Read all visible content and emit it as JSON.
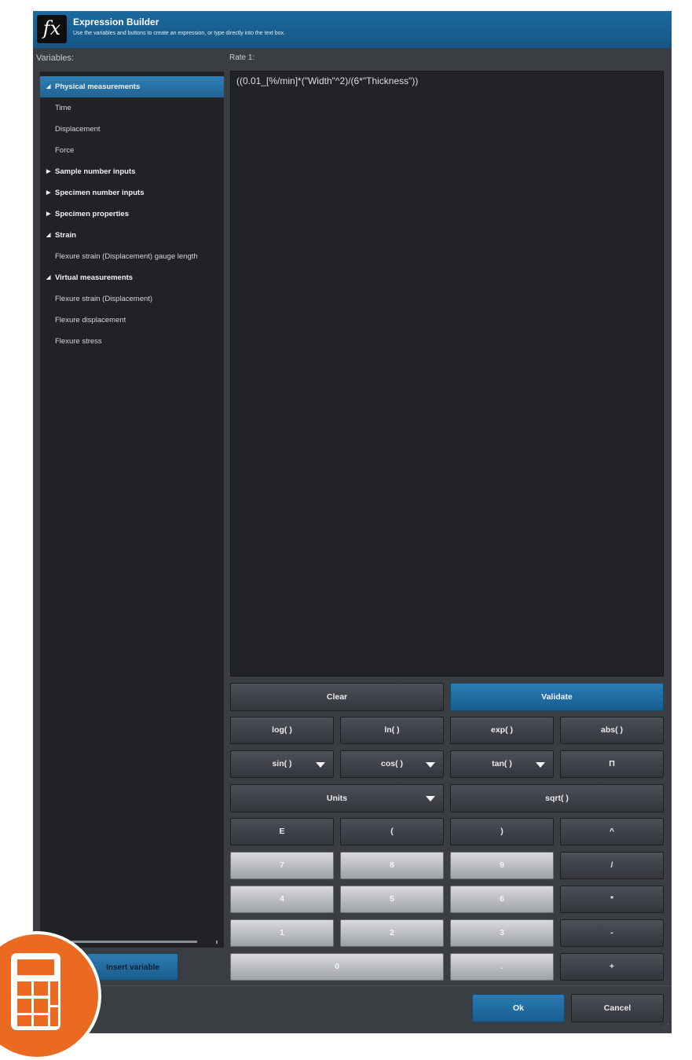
{
  "window": {
    "title": "Expression Builder",
    "subtitle": "Use the variables and buttons to create an expression, or type directly into the text box.",
    "icon": "fx-icon"
  },
  "variables": {
    "label": "Variables:",
    "tree": [
      {
        "label": "Physical measurements",
        "type": "group",
        "expanded": true,
        "selected": true
      },
      {
        "label": "Time",
        "type": "leaf"
      },
      {
        "label": "Displacement",
        "type": "leaf"
      },
      {
        "label": "Force",
        "type": "leaf"
      },
      {
        "label": "Sample number inputs",
        "type": "group",
        "expanded": false
      },
      {
        "label": "Specimen number inputs",
        "type": "group",
        "expanded": false
      },
      {
        "label": "Specimen properties",
        "type": "group",
        "expanded": false
      },
      {
        "label": "Strain",
        "type": "group",
        "expanded": true
      },
      {
        "label": "Flexure strain (Displacement) gauge length",
        "type": "leaf"
      },
      {
        "label": "Virtual measurements",
        "type": "group",
        "expanded": true
      },
      {
        "label": "Flexure strain (Displacement)",
        "type": "leaf"
      },
      {
        "label": "Flexure displacement",
        "type": "leaf"
      },
      {
        "label": "Flexure stress",
        "type": "leaf"
      }
    ],
    "insert_button": "Insert variable"
  },
  "expression": {
    "label": "Rate 1:",
    "value": "((0.01_[%/min]*(\"Width\"^2)/(6*\"Thickness\"))"
  },
  "buttons": {
    "clear": "Clear",
    "validate": "Validate",
    "log": "log( )",
    "ln": "ln( )",
    "exp": "exp( )",
    "abs": "abs( )",
    "sin": "sin( )",
    "cos": "cos( )",
    "tan": "tan( )",
    "pi": "Π",
    "units": "Units",
    "sqrt": "sqrt( )",
    "e": "E",
    "lparen": "(",
    "rparen": ")",
    "caret": "^",
    "n7": "7",
    "n8": "8",
    "n9": "9",
    "div": "/",
    "n4": "4",
    "n5": "5",
    "n6": "6",
    "mul": "*",
    "n1": "1",
    "n2": "2",
    "n3": "3",
    "minus": "-",
    "n0": "0",
    "dot": ".",
    "plus": "+"
  },
  "footer": {
    "ok": "Ok",
    "cancel": "Cancel"
  },
  "colors": {
    "accent": "#1c6aa0",
    "panel": "#3a3d42",
    "badge": "#e96a20"
  }
}
